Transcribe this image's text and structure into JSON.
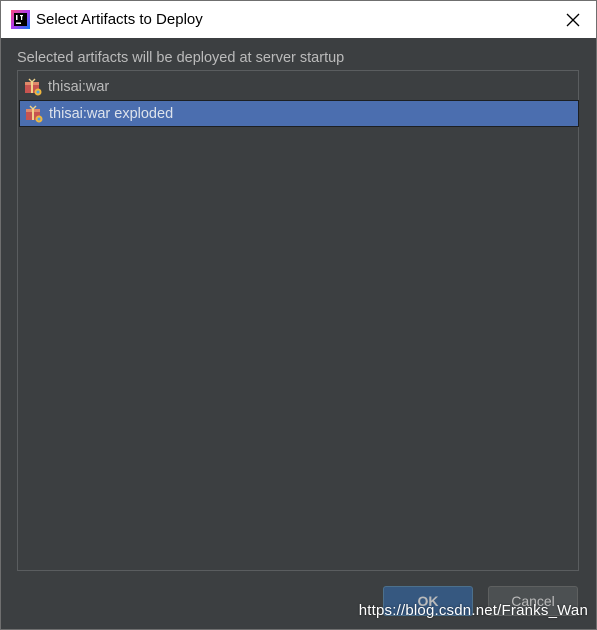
{
  "window": {
    "title": "Select Artifacts to Deploy",
    "app_icon": "intellij-idea-icon",
    "close_icon": "close-icon"
  },
  "dialog": {
    "instruction": "Selected artifacts will be deployed at server startup",
    "artifacts": [
      {
        "label": "thisai:war",
        "icon": "artifact-war-icon",
        "selected": false
      },
      {
        "label": "thisai:war exploded",
        "icon": "artifact-war-exploded-icon",
        "selected": true
      }
    ],
    "ok_label": "OK",
    "cancel_label": "Cancel"
  },
  "watermark": "https://blog.csdn.net/Franks_Wan",
  "colors": {
    "background": "#3c3f41",
    "selection": "#4b6eaf",
    "text": "#bbbbbb",
    "ok_button": "#365880"
  }
}
